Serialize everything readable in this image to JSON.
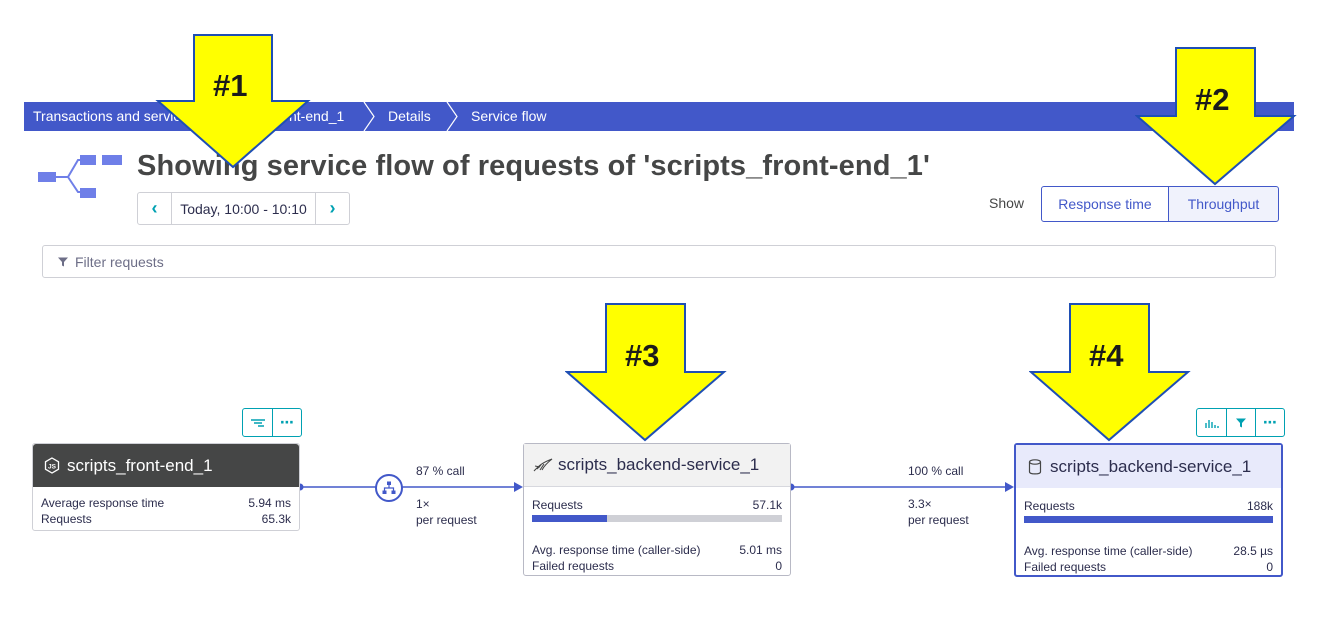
{
  "breadcrumb": {
    "items": [
      {
        "label": "Transactions and services"
      },
      {
        "label": "scripts_front-end_1"
      },
      {
        "label": "Details"
      },
      {
        "label": "Service flow"
      }
    ]
  },
  "header": {
    "title": "Showing service flow of requests of 'scripts_front-end_1'",
    "timeframe": "Today, 10:00 - 10:10",
    "prev_icon": "chevron-left-icon",
    "next_icon": "chevron-right-icon"
  },
  "show": {
    "label": "Show",
    "options": [
      "Response time",
      "Throughput"
    ],
    "selected": "Throughput"
  },
  "filter": {
    "placeholder": "Filter requests",
    "icon": "funnel-icon"
  },
  "nodes": [
    {
      "name": "scripts_front-end_1",
      "icon": "nodejs-icon",
      "metrics": [
        {
          "label": "Average response time",
          "value": "5.94 ms"
        },
        {
          "label": "Requests",
          "value": "65.3k"
        }
      ]
    },
    {
      "name": "scripts_backend-service_1",
      "icon": "apache-feather-icon",
      "requests_label": "Requests",
      "requests_value": "57.1k",
      "requests_share": 0.3,
      "metrics": [
        {
          "label": "Avg. response time (caller-side)",
          "value": "5.01 ms"
        },
        {
          "label": "Failed requests",
          "value": "0"
        }
      ]
    },
    {
      "name": "scripts_backend-service_1",
      "icon": "database-icon",
      "requests_label": "Requests",
      "requests_value": "188k",
      "requests_share": 1.0,
      "metrics": [
        {
          "label": "Avg. response time (caller-side)",
          "value": "28.5 µs"
        },
        {
          "label": "Failed requests",
          "value": "0"
        }
      ]
    }
  ],
  "edges": [
    {
      "call_pct": "87 % call",
      "per_request_1": "1×",
      "per_request_2": "per request"
    },
    {
      "call_pct": "100 % call",
      "per_request_1": "3.3×",
      "per_request_2": "per request"
    }
  ],
  "toolbars": {
    "node1": [
      "waterfall-icon",
      "more-icon"
    ],
    "node3": [
      "chart-icon",
      "filter-icon",
      "more-icon"
    ]
  },
  "callouts": [
    "#1",
    "#2",
    "#3",
    "#4"
  ],
  "colors": {
    "brand": "#4258c9",
    "accent": "#00a1b2",
    "callout_fill": "#ffff00",
    "callout_stroke": "#1f4fb4"
  }
}
